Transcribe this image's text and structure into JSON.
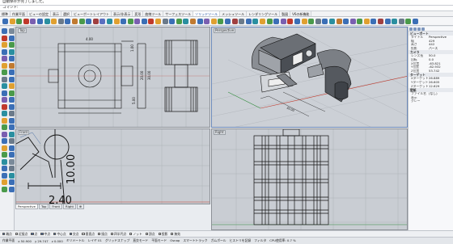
{
  "command": {
    "history_line": "自動保存が完了しました。",
    "prompt_label": "コマンド:",
    "input_value": ""
  },
  "tabs": [
    "標準",
    "作業平面",
    "ビューの設定",
    "表示",
    "選択",
    "ビューポートレイアウト",
    "表示/非表示",
    "変形",
    "曲線ツール",
    "サーフェスツール",
    "ソリッドツール",
    "メッシュツール",
    "レンダリングツール",
    "製図",
    "V6の新機能"
  ],
  "active_tab_index": 10,
  "viewports": {
    "top_left": {
      "title": "Top"
    },
    "perspective": {
      "title": "Perspective"
    },
    "bottom_left": {
      "title": "Front"
    },
    "bottom_right": {
      "title": "Right"
    },
    "dimensions": {
      "top_dim": "4.00",
      "right_dim_a": "20.00",
      "right_dim_b": "30.00",
      "bottom_dim": "5.00",
      "small_dim": "1.00",
      "front_dim_v": "10.00",
      "front_dim_h": "2.40"
    }
  },
  "viewport_tabs": [
    {
      "label": "Perspective",
      "active": true
    },
    {
      "label": "Top",
      "active": false
    },
    {
      "label": "Front",
      "active": false
    },
    {
      "label": "Right",
      "active": false
    },
    {
      "label": "⊕",
      "active": false
    }
  ],
  "properties": {
    "section_view": "ビューポート",
    "rows_view": [
      {
        "k": "タイトル",
        "v": "Perspective"
      },
      {
        "k": "幅",
        "v": "429"
      },
      {
        "k": "高さ",
        "v": "442"
      },
      {
        "k": "投影",
        "v": "パース"
      }
    ],
    "section_camera": "カメラ",
    "rows_camera": [
      {
        "k": "レンズ長",
        "v": "50.0"
      },
      {
        "k": "回転",
        "v": "0.0"
      },
      {
        "k": "X位置",
        "v": "-63.821"
      },
      {
        "k": "Y位置",
        "v": "-62.932"
      },
      {
        "k": "Z位置",
        "v": "53.742"
      }
    ],
    "section_target": "ターゲット",
    "rows_target": [
      {
        "k": "Xターゲット",
        "v": "26.889"
      },
      {
        "k": "Yターゲット",
        "v": "26.605"
      },
      {
        "k": "Zターゲット",
        "v": "12.629"
      }
    ],
    "section_wallpaper": "壁紙",
    "rows_wallpaper": [
      {
        "k": "ファイル名",
        "v": "(なし)"
      },
      {
        "k": "表示",
        "v": ""
      },
      {
        "k": "グレー",
        "v": ""
      }
    ]
  },
  "osnap": [
    {
      "label": "端点",
      "on": true
    },
    {
      "label": "近接点",
      "on": false
    },
    {
      "label": "点",
      "on": true
    },
    {
      "label": "中点",
      "on": true
    },
    {
      "label": "中心点",
      "on": true
    },
    {
      "label": "交点",
      "on": true
    },
    {
      "label": "垂直点",
      "on": false
    },
    {
      "label": "接点",
      "on": false
    },
    {
      "label": "四半円点",
      "on": false
    },
    {
      "label": "ノット",
      "on": false
    },
    {
      "label": "頂点",
      "on": false
    },
    {
      "label": "投影",
      "on": false
    },
    {
      "label": "無効",
      "on": false
    }
  ],
  "status": {
    "plane": "作業平面",
    "x": "x 50.900",
    "y": "y 29.747",
    "z": "z 0.000",
    "unit": "ミリメートル",
    "layer": "レイヤ 01",
    "items": [
      "グリッドスナップ",
      "直交モード",
      "平面モード",
      "Osnap",
      "スマートトラック",
      "ガムボール",
      "ヒストリを記録",
      "フィルタ",
      "CPU使用率: 0.7 %"
    ]
  },
  "colors": {
    "active_tab": "#1a4ca0",
    "viewport_bg": "#c9cdd3",
    "x_axis": "#c0392b",
    "y_axis": "#2e8b3a"
  }
}
